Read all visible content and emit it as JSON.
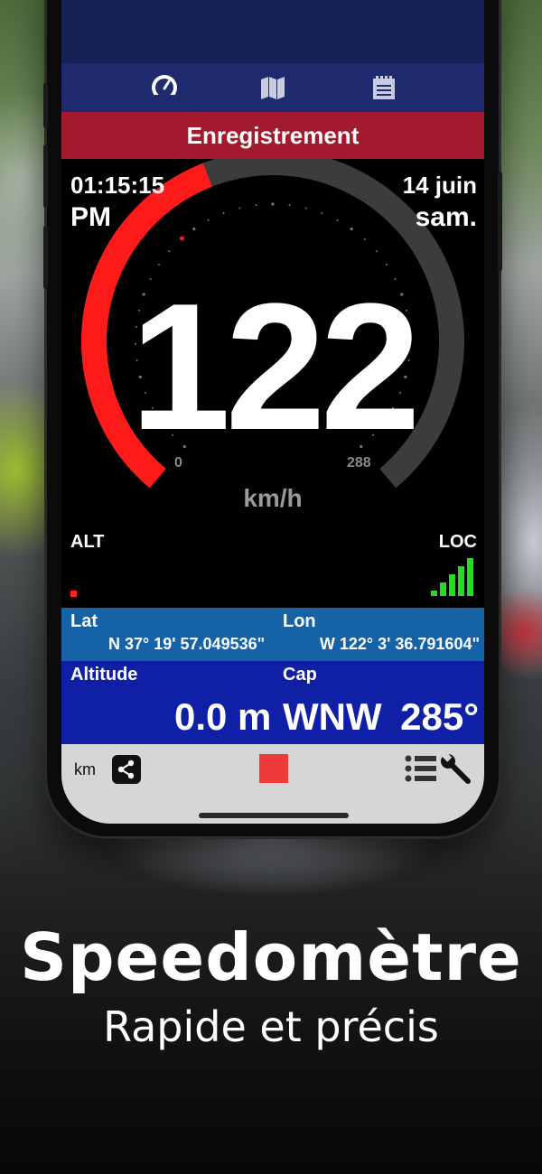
{
  "tabs": [
    {
      "icon": "speedometer-icon",
      "active": true
    },
    {
      "icon": "map-icon",
      "active": false
    },
    {
      "icon": "notepad-icon",
      "active": false
    }
  ],
  "record_bar": {
    "label": "Enregistrement",
    "color": "#a3192d"
  },
  "dashboard": {
    "time": "01:15:15",
    "ampm": "PM",
    "date": "14 juin",
    "weekday": "sam.",
    "speed": "122",
    "unit": "km/h",
    "gauge_min": "0",
    "gauge_max": "288",
    "gauge_fraction": 0.4236,
    "alt_label": "ALT",
    "loc_label": "LOC",
    "signal_level": 5,
    "colors": {
      "arc_active": "#ff1a1a",
      "arc_track": "#3c3c3c",
      "signal": "#22dd22"
    }
  },
  "coords": {
    "lat_label": "Lat",
    "lat_value": "N 37° 19' 57.049536\"",
    "lon_label": "Lon",
    "lon_value": "W 122° 3' 36.791604\""
  },
  "info": {
    "altitude_label": "Altitude",
    "altitude_value": "0.0 m",
    "cap_label": "Cap",
    "cap_direction": "WNW",
    "cap_degrees": "285°"
  },
  "toolbar": {
    "unit_toggle": "km",
    "share_icon": "share-icon",
    "stop_icon": "stop-icon",
    "list_icon": "list-icon",
    "settings_icon": "wrench-icon",
    "stop_color": "#f03a3a"
  },
  "marketing": {
    "headline": "Speedomètre",
    "subheadline": "Rapide et précis"
  }
}
